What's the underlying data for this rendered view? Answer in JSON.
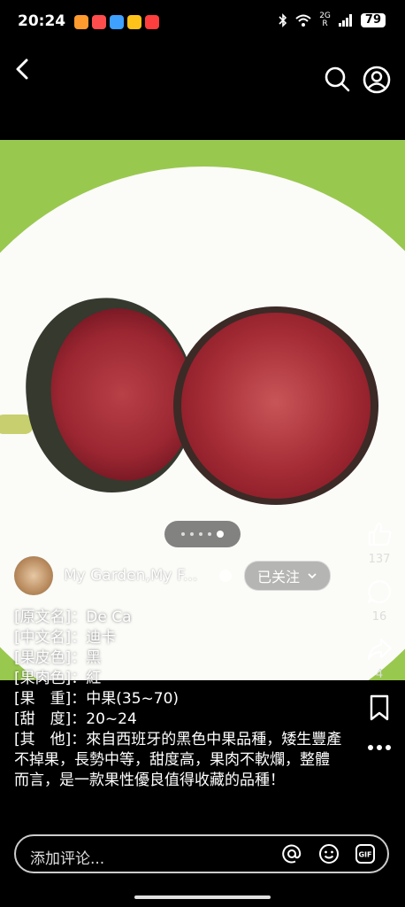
{
  "status_bar": {
    "time": "20:24",
    "network": "2G",
    "signal_prefix": "R",
    "battery": "79",
    "app_icon_colors": [
      "#ff9a2e",
      "#ff4d4d",
      "#3ea0ff",
      "#ffc21a",
      "#ff3e3e"
    ]
  },
  "top_bar": {
    "back_icon": "back-arrow-icon",
    "search_icon": "search-icon",
    "profile_icon": "profile-icon"
  },
  "photo": {
    "page_indicator": {
      "total": 5,
      "current": 5
    }
  },
  "author": {
    "name": "My Garden,My F...",
    "follow_label": "已关注"
  },
  "description": {
    "lines": [
      "[原文名]：De Ca",
      "[中文名]：迪卡",
      "[果皮色]：黑",
      "[果肉色]：紅",
      "[果　重]：中果(35~70)",
      "[甜　度]：20~24"
    ],
    "other": "[其　他]：來自西班牙的黑色中果品種，矮生豐產不掉果，長勢中等，甜度高，果肉不軟爛，整體而言，是一款果性優良值得收藏的品種！"
  },
  "actions": {
    "likes": "137",
    "comments": "16",
    "shares": "4"
  },
  "comment_bar": {
    "placeholder": "添加评论...",
    "gif_label": "GIF"
  },
  "colors": {
    "background": "#000000",
    "plate_rim": "#99c84f"
  }
}
